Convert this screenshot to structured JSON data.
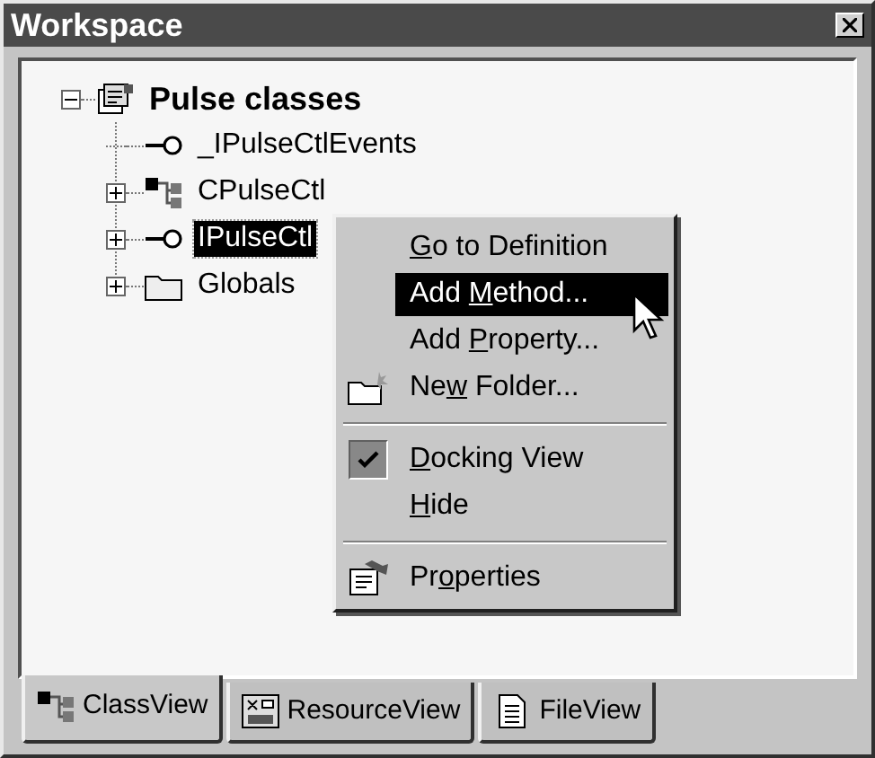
{
  "window": {
    "title": "Workspace"
  },
  "tree": [
    {
      "label": "Pulse classes",
      "kind": "project",
      "expanded": true,
      "selected": false,
      "children": [
        {
          "label": "_IPulseCtlEvents",
          "kind": "interface",
          "selected": false
        },
        {
          "label": "CPulseCtl",
          "kind": "class",
          "expanded": false,
          "selected": false
        },
        {
          "label": "IPulseCtl",
          "kind": "interface",
          "expanded": false,
          "selected": true
        },
        {
          "label": "Globals",
          "kind": "folder",
          "expanded": false,
          "selected": false
        }
      ]
    }
  ],
  "context_menu": [
    {
      "kind": "command",
      "label": {
        "key": "G",
        "after": "o to Definition"
      },
      "highlighted": false
    },
    {
      "kind": "command",
      "label": {
        "before": "Add ",
        "key": "M",
        "after": "ethod..."
      },
      "highlighted": true
    },
    {
      "kind": "command",
      "label": {
        "before": "Add ",
        "key": "P",
        "after": "roperty..."
      },
      "highlighted": false
    },
    {
      "kind": "folder_command",
      "label": {
        "before": "Ne",
        "key": "w",
        "after": " Folder..."
      },
      "highlighted": false
    },
    {
      "kind": "separator"
    },
    {
      "kind": "check",
      "label": {
        "key": "D",
        "after": "ocking View"
      },
      "checked": true,
      "highlighted": false
    },
    {
      "kind": "command",
      "label": {
        "key": "H",
        "after": "ide"
      },
      "highlighted": false
    },
    {
      "kind": "separator"
    },
    {
      "kind": "properties_command",
      "label": {
        "before": "Pr",
        "key": "o",
        "after": "perties"
      },
      "highlighted": false
    }
  ],
  "tabs": [
    {
      "label": "ClassView",
      "kind": "class",
      "selected": true
    },
    {
      "label": "ResourceView",
      "kind": "resource",
      "selected": false
    },
    {
      "label": "FileView",
      "kind": "file",
      "selected": false
    }
  ]
}
